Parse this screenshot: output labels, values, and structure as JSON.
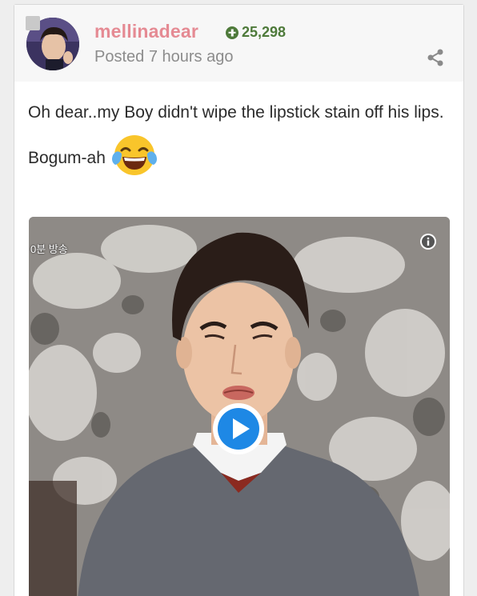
{
  "post": {
    "author": "mellinadear",
    "reputation": "25,298",
    "posted": "Posted 7 hours ago",
    "body_line1": "Oh dear..my Boy didn't wipe the lipstick stain off his lips.",
    "body_line2": "Bogum-ah",
    "emoji": "face-with-tears-of-joy"
  },
  "video": {
    "caption": "0분 방송",
    "state": "paused"
  },
  "colors": {
    "author": "#e58a93",
    "reputation": "#4e7a3a",
    "timestamp": "#8c8c8c",
    "play": "#1e88e5"
  }
}
